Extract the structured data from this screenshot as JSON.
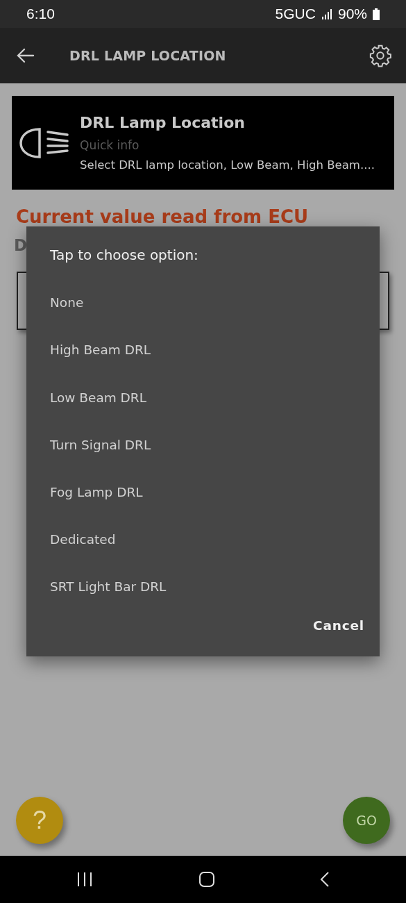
{
  "status_bar": {
    "time": "6:10",
    "network": "5GUC",
    "battery": "90%"
  },
  "app_bar": {
    "title": "DRL LAMP LOCATION"
  },
  "info_card": {
    "title": "DRL Lamp Location",
    "subtitle": "Quick info",
    "description": "Select DRL lamp location, Low Beam, High Beam...."
  },
  "current_value": {
    "heading": "Current value read from ECU",
    "value": "D"
  },
  "dialog": {
    "title": "Tap to choose option:",
    "options": [
      "None",
      "High Beam DRL",
      "Low Beam DRL",
      "Turn Signal DRL",
      "Fog Lamp DRL",
      "Dedicated",
      "SRT Light Bar DRL"
    ],
    "cancel": "Cancel"
  },
  "help_button": {
    "label": "?"
  },
  "go_button": {
    "label": "GO"
  }
}
